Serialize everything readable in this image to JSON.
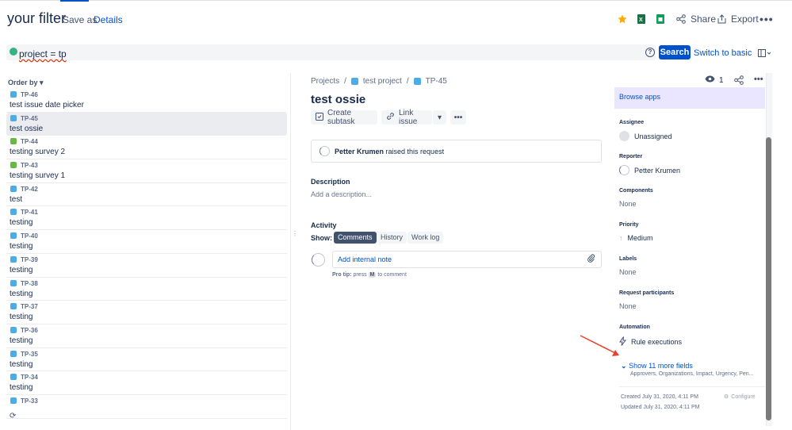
{
  "header": {
    "title": "your filter",
    "save_as": "Save as",
    "details": "Details",
    "share": "Share",
    "export": "Export"
  },
  "jql": {
    "query": "project = tp",
    "search": "Search",
    "switch": "Switch to basic"
  },
  "list": {
    "order_by": "Order by",
    "items": [
      {
        "key": "TP-46",
        "summary": "test issue date picker",
        "type": "task"
      },
      {
        "key": "TP-45",
        "summary": "test ossie",
        "type": "task",
        "selected": true
      },
      {
        "key": "TP-44",
        "summary": "testing survey 2",
        "type": "story"
      },
      {
        "key": "TP-43",
        "summary": "testing survey 1",
        "type": "story"
      },
      {
        "key": "TP-42",
        "summary": "test",
        "type": "task"
      },
      {
        "key": "TP-41",
        "summary": "testing",
        "type": "task"
      },
      {
        "key": "TP-40",
        "summary": "testing",
        "type": "task"
      },
      {
        "key": "TP-39",
        "summary": "testing",
        "type": "task"
      },
      {
        "key": "TP-38",
        "summary": "testing",
        "type": "task"
      },
      {
        "key": "TP-37",
        "summary": "testing",
        "type": "task"
      },
      {
        "key": "TP-36",
        "summary": "testing",
        "type": "task"
      },
      {
        "key": "TP-35",
        "summary": "testing",
        "type": "task"
      },
      {
        "key": "TP-34",
        "summary": "testing",
        "type": "task"
      },
      {
        "key": "TP-33",
        "summary": "",
        "type": "task"
      }
    ]
  },
  "issue": {
    "crumb_projects": "Projects",
    "crumb_project": "test project",
    "crumb_key": "TP-45",
    "title": "test ossie",
    "create_subtask": "Create subtask",
    "link_issue": "Link issue",
    "reporter_name": "Petter Krumen",
    "raised_suffix": "raised this request",
    "description_h": "Description",
    "description_ph": "Add a description...",
    "activity_h": "Activity",
    "show_lbl": "Show:",
    "tabs": [
      "Comments",
      "History",
      "Work log"
    ],
    "note_ph": "Add internal note",
    "protip_b": "Pro tip:",
    "protip_press": "press",
    "protip_key": "M",
    "protip_rest": "to comment"
  },
  "panel": {
    "watch_count": "1",
    "browse_apps": "Browse apps",
    "assignee_lbl": "Assignee",
    "assignee_val": "Unassigned",
    "reporter_lbl": "Reporter",
    "reporter_val": "Petter Krumen",
    "components_lbl": "Components",
    "components_val": "None",
    "priority_lbl": "Priority",
    "priority_val": "Medium",
    "labels_lbl": "Labels",
    "labels_val": "None",
    "participants_lbl": "Request participants",
    "participants_val": "None",
    "automation_lbl": "Automation",
    "automation_val": "Rule executions",
    "more_fields": "Show 11 more fields",
    "more_sub": "Approvers, Organizations, Impact, Urgency, Pen...",
    "created": "Created July 31, 2020, 4:11 PM",
    "updated": "Updated July 31, 2020, 4:11 PM",
    "configure": "Configure"
  },
  "colors": {
    "accent": "#0052cc",
    "star": "#ffab00",
    "arrow": "#e8402b"
  }
}
